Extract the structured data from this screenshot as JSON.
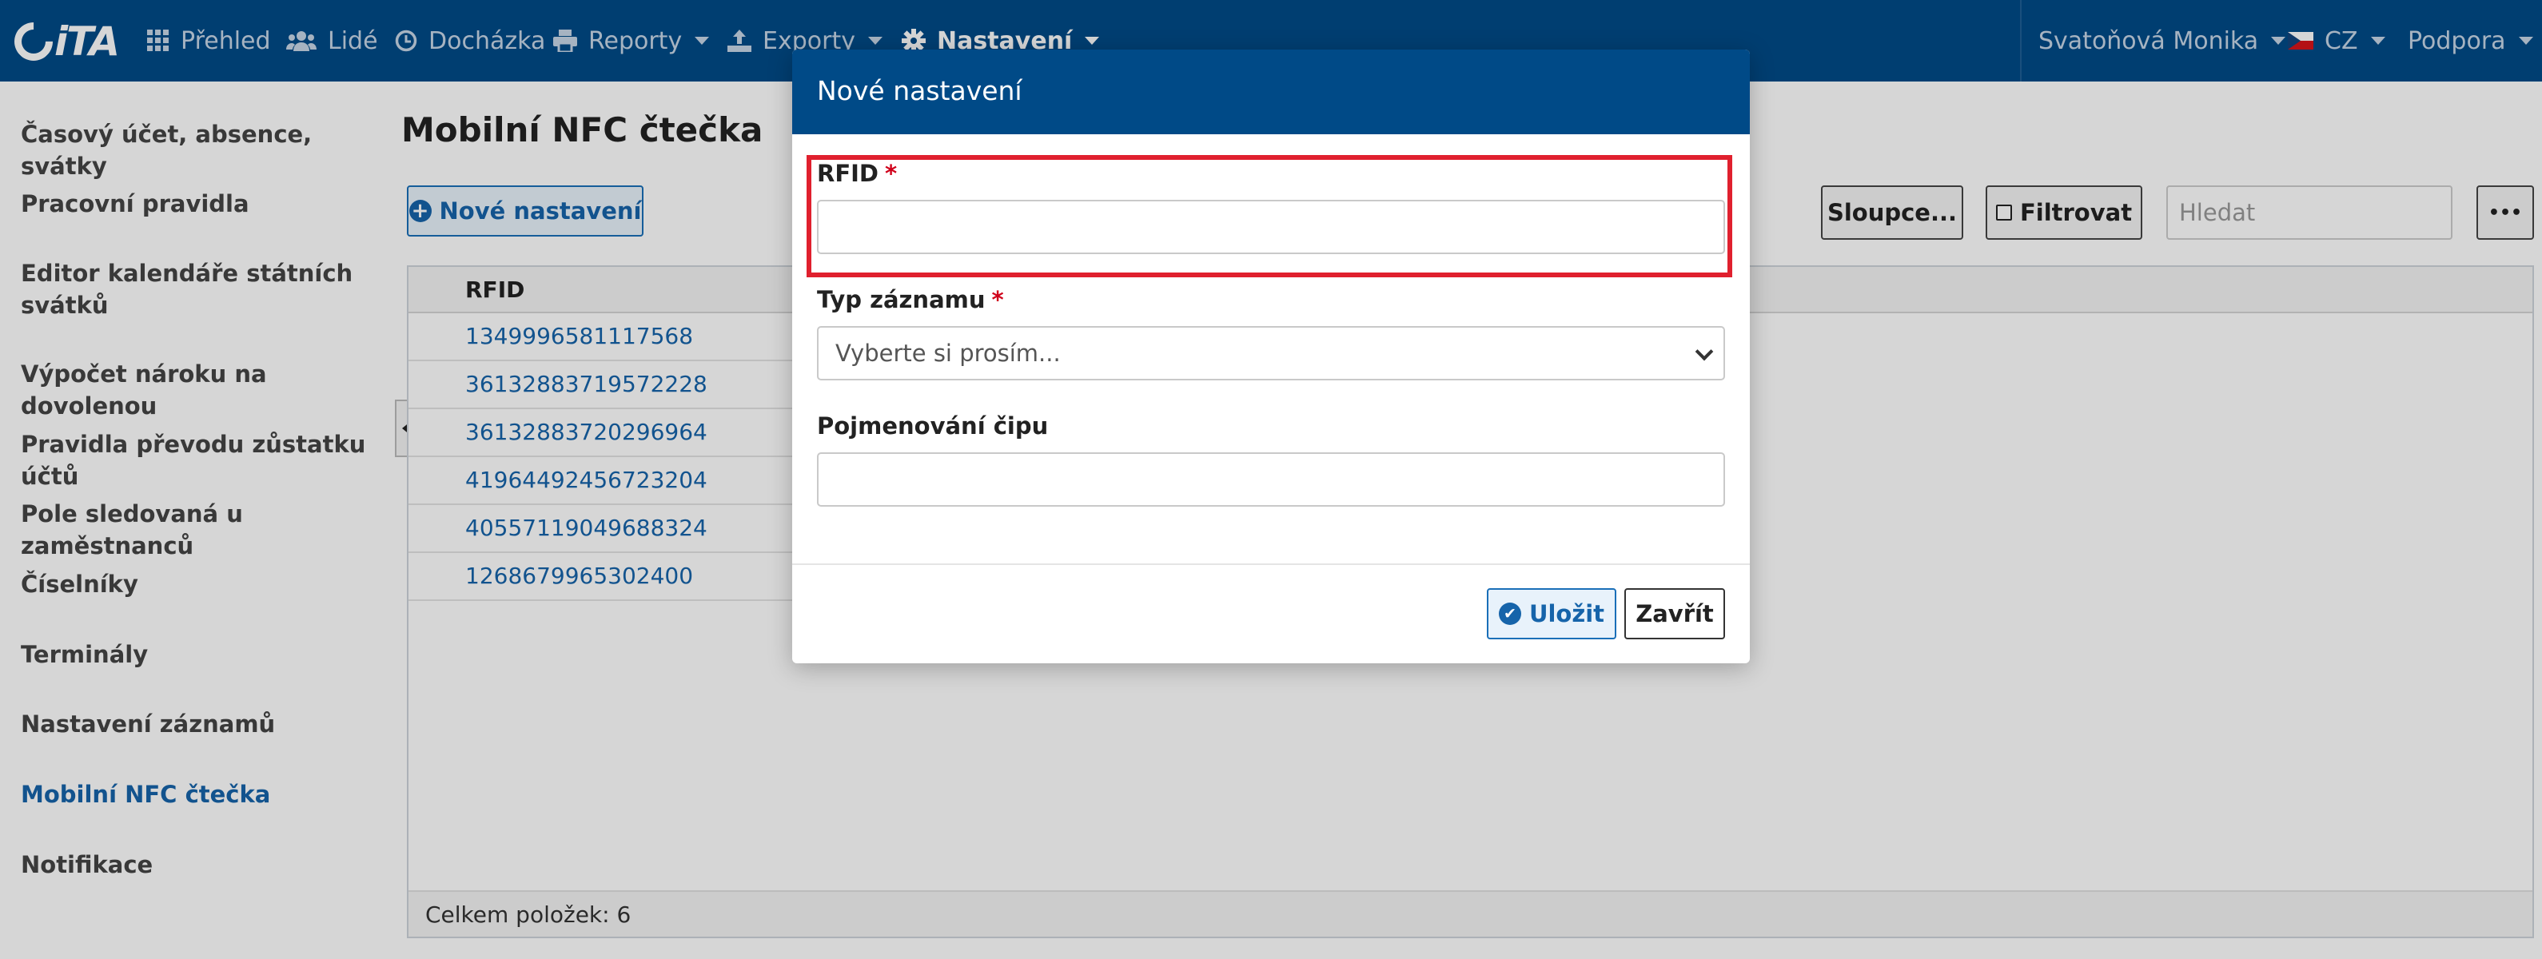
{
  "logo": {
    "text": "iTA"
  },
  "nav": {
    "overview": "Přehled",
    "people": "Lidé",
    "attendance": "Docházka",
    "reports": "Reporty",
    "exports": "Exporty",
    "settings": "Nastavení",
    "user": "Svatoňová Monika",
    "language": "CZ",
    "support": "Podpora"
  },
  "sidebar": {
    "items": [
      {
        "label": "Časový účet, absence, svátky"
      },
      {
        "label": "Pracovní pravidla"
      },
      {
        "label": "Editor kalendáře státních svátků"
      },
      {
        "label": "Výpočet nároku na dovolenou"
      },
      {
        "label": "Pravidla převodu zůstatku účtů"
      },
      {
        "label": "Pole sledovaná u zaměstnanců"
      },
      {
        "label": "Číselníky"
      },
      {
        "label": "Terminály"
      },
      {
        "label": "Nastavení záznamů"
      },
      {
        "label": "Mobilní NFC čtečka"
      },
      {
        "label": "Notifikace"
      }
    ]
  },
  "main": {
    "title": "Mobilní NFC čtečka",
    "new_button": "Nové nastavení",
    "columns_button": "Sloupce...",
    "filter_button": "Filtrovat",
    "search_placeholder": "Hledat",
    "more_button": "•••",
    "column_header": "RFID",
    "rows": [
      "1349996581117568",
      "36132883719572228",
      "36132883720296964",
      "41964492456723204",
      "40557119049688324",
      "1268679965302400"
    ],
    "footer": "Celkem položek: 6"
  },
  "modal": {
    "title": "Nové nastavení",
    "rfid_label": "RFID",
    "required_mark": "*",
    "rfid_value": "",
    "type_label": "Typ záznamu",
    "type_selected": "Vyberte si prosím...",
    "chip_label": "Pojmenování čipu",
    "chip_value": "",
    "save_button": "Uložit",
    "close_button": "Zavřít"
  },
  "colors": {
    "nav_bg": "#004a87",
    "accent": "#1664aa",
    "required": "#d0021b",
    "highlight": "#e0202e"
  }
}
